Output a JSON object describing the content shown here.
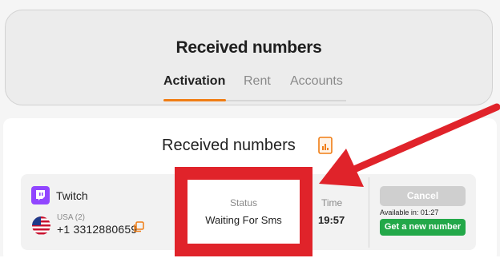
{
  "header": {
    "title": "Received numbers",
    "tabs": [
      {
        "label": "Activation",
        "active": true
      },
      {
        "label": "Rent",
        "active": false
      },
      {
        "label": "Accounts",
        "active": false
      }
    ]
  },
  "section": {
    "title": "Received numbers",
    "icon": "document-icon"
  },
  "activation": {
    "service": "Twitch",
    "service_icon": "twitch-icon",
    "country": "USA (2)",
    "country_flag": "usa-flag-icon",
    "phone": "+1 3312880659",
    "status_label": "Status",
    "status": "Waiting For Sms",
    "time_label": "Time",
    "time": "19:57",
    "cancel_label": "Cancel",
    "available_label": "Available in:",
    "available_time": "01:27",
    "new_number_label": "Get a new number"
  },
  "colors": {
    "accent": "#f07d14",
    "twitch": "#9146ff",
    "success": "#23a849",
    "highlight": "#e0232a"
  }
}
